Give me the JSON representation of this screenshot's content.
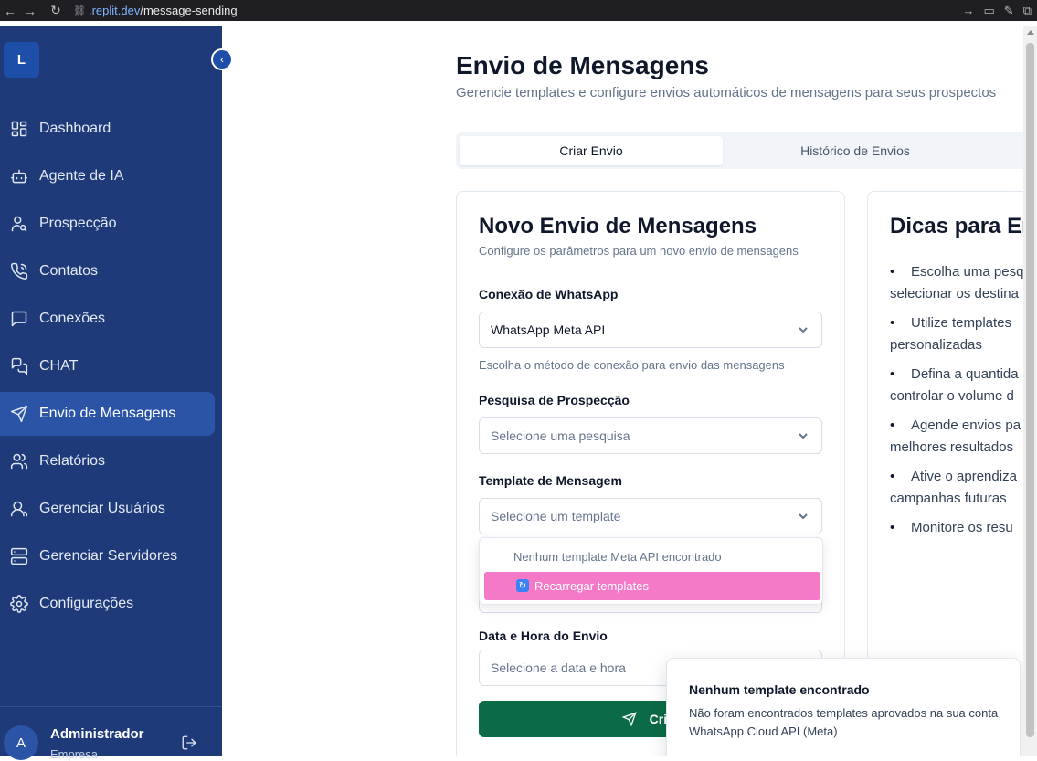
{
  "browser": {
    "url_host": ".replit.dev",
    "url_path": "/message-sending"
  },
  "sidebar": {
    "logo_letter": "L",
    "items": [
      {
        "label": "Dashboard",
        "icon": "dashboard-icon"
      },
      {
        "label": "Agente de IA",
        "icon": "bot-icon"
      },
      {
        "label": "Prospecção",
        "icon": "user-search-icon"
      },
      {
        "label": "Contatos",
        "icon": "phone-icon"
      },
      {
        "label": "Conexões",
        "icon": "message-square-icon"
      },
      {
        "label": "CHAT",
        "icon": "messages-icon"
      },
      {
        "label": "Envio de Mensagens",
        "icon": "send-icon",
        "active": true
      },
      {
        "label": "Relatórios",
        "icon": "users-icon"
      },
      {
        "label": "Gerenciar Usuários",
        "icon": "user-icon"
      },
      {
        "label": "Gerenciar Servidores",
        "icon": "server-icon"
      },
      {
        "label": "Configurações",
        "icon": "gear-icon"
      }
    ],
    "user": {
      "avatar_letter": "A",
      "name": "Administrador",
      "role": "Empresa"
    }
  },
  "header": {
    "title": "Envio de Mensagens",
    "subtitle": "Gerencie templates e configure envios automáticos de mensagens para seus prospectos"
  },
  "tabs": [
    {
      "label": "Criar Envio",
      "active": true
    },
    {
      "label": "Histórico de Envios",
      "active": false
    }
  ],
  "form": {
    "title": "Novo Envio de Mensagens",
    "description": "Configure os parâmetros para um novo envio de mensagens",
    "connection_label": "Conexão de WhatsApp",
    "connection_value": "WhatsApp Meta API",
    "connection_hint": "Escolha o método de conexão para envio das mensagens",
    "search_label": "Pesquisa de Prospecção",
    "search_placeholder": "Selecione uma pesquisa",
    "template_label": "Template de Mensagem",
    "template_placeholder": "Selecione um template",
    "template_dropdown": {
      "empty_text": "Nenhum template Meta API encontrado",
      "reload_label": "Recarregar templates"
    },
    "datetime_label": "Data e Hora do Envio",
    "datetime_placeholder": "Selecione a data e hora",
    "submit_label": "Criar"
  },
  "tips": {
    "title": "Dicas para Env",
    "items": [
      {
        "line1": "Escolha uma pesq",
        "line2": "selecionar os destina"
      },
      {
        "line1": "Utilize templates",
        "line2": "personalizadas"
      },
      {
        "line1": "Defina a quantida",
        "line2": "controlar o volume d"
      },
      {
        "line1": "Agende envios pa",
        "line2": "melhores resultados"
      },
      {
        "line1": "Ative o aprendiza",
        "line2": "campanhas futuras"
      },
      {
        "line1": "Monitore os resu",
        "line2": ""
      }
    ]
  },
  "toast": {
    "title": "Nenhum template encontrado",
    "body": "Não foram encontrados templates aprovados na sua conta WhatsApp Cloud API (Meta)"
  },
  "colors": {
    "sidebar_bg": "#1e3a78",
    "sidebar_active": "#2c54a6",
    "primary_button": "#0b6b46",
    "highlight_item": "#f47ac8"
  }
}
